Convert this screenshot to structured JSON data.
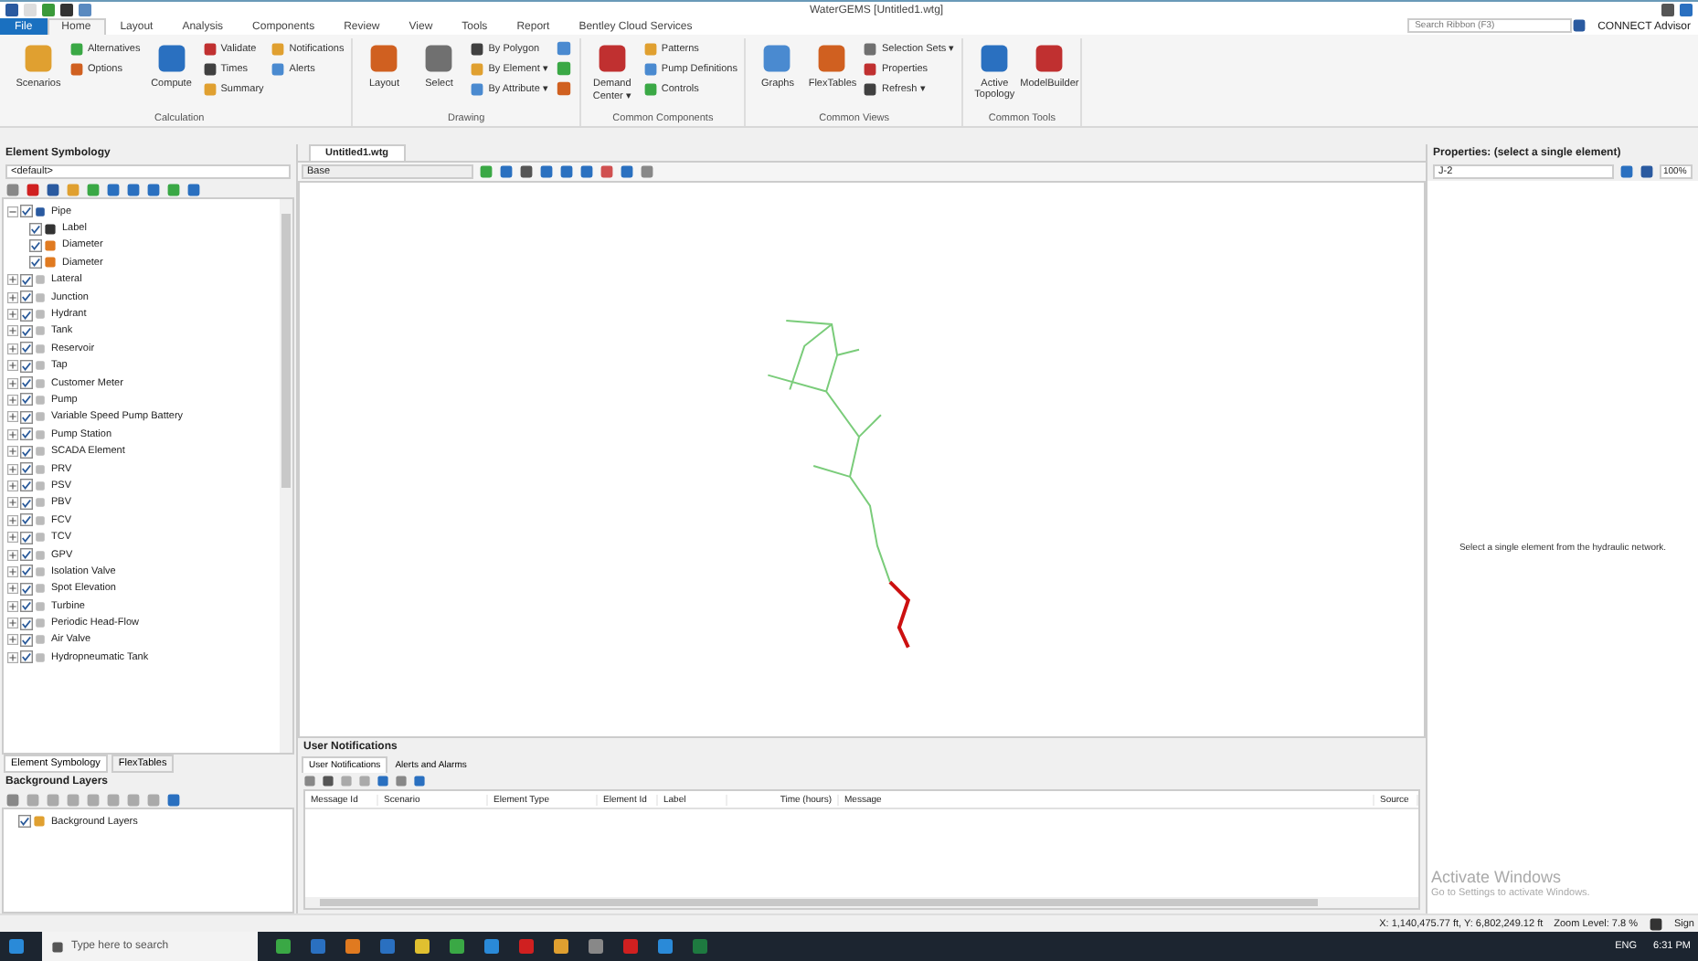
{
  "window": {
    "title": "WaterGEMS [Untitled1.wtg]"
  },
  "ribbon_tabs": [
    {
      "label": "File",
      "selected": false,
      "kind": "file"
    },
    {
      "label": "Home",
      "selected": true
    },
    {
      "label": "Layout",
      "selected": false
    },
    {
      "label": "Analysis",
      "selected": false
    },
    {
      "label": "Components",
      "selected": false
    },
    {
      "label": "Review",
      "selected": false
    },
    {
      "label": "View",
      "selected": false
    },
    {
      "label": "Tools",
      "selected": false
    },
    {
      "label": "Report",
      "selected": false
    },
    {
      "label": "Bentley Cloud Services",
      "selected": false
    }
  ],
  "ribbon_search": {
    "placeholder": "Search Ribbon (F3)"
  },
  "advisor": "CONNECT Advisor",
  "ribbon_groups": [
    {
      "label": "Calculation",
      "columns": [
        [
          {
            "kind": "large",
            "label": "Scenarios"
          }
        ],
        [
          {
            "kind": "small",
            "label": "Alternatives"
          },
          {
            "kind": "small",
            "label": "Options"
          }
        ],
        [
          {
            "kind": "large",
            "label": "Compute"
          }
        ],
        [
          {
            "kind": "small",
            "label": "Validate"
          },
          {
            "kind": "small",
            "label": "Times"
          },
          {
            "kind": "small",
            "label": "Summary"
          }
        ],
        [
          {
            "kind": "small",
            "label": "Notifications"
          },
          {
            "kind": "small",
            "label": "Alerts"
          }
        ]
      ]
    },
    {
      "label": "Drawing",
      "columns": [
        [
          {
            "kind": "large",
            "label": "Layout"
          }
        ],
        [
          {
            "kind": "large",
            "label": "Select"
          }
        ],
        [
          {
            "kind": "small",
            "label": "By Polygon"
          },
          {
            "kind": "small",
            "label": "By Element ▾"
          },
          {
            "kind": "small",
            "label": "By Attribute ▾"
          }
        ],
        [
          {
            "kind": "icon"
          },
          {
            "kind": "icon"
          },
          {
            "kind": "icon"
          }
        ]
      ]
    },
    {
      "label": "Common Components",
      "columns": [
        [
          {
            "kind": "large",
            "label": "Demand Center ▾"
          }
        ],
        [
          {
            "kind": "small",
            "label": "Patterns"
          },
          {
            "kind": "small",
            "label": "Pump Definitions"
          },
          {
            "kind": "small",
            "label": "Controls"
          }
        ]
      ]
    },
    {
      "label": "Common Views",
      "columns": [
        [
          {
            "kind": "large",
            "label": "Graphs"
          }
        ],
        [
          {
            "kind": "large",
            "label": "FlexTables"
          }
        ],
        [
          {
            "kind": "small",
            "label": "Selection Sets ▾"
          },
          {
            "kind": "small",
            "label": "Properties"
          },
          {
            "kind": "small",
            "label": "Refresh ▾"
          }
        ]
      ]
    },
    {
      "label": "Common Tools",
      "columns": [
        [
          {
            "kind": "large",
            "label": "Active Topology"
          }
        ],
        [
          {
            "kind": "large",
            "label": "ModelBuilder"
          }
        ]
      ]
    }
  ],
  "element_symbology": {
    "title": "Element Symbology",
    "dropdown": "<default>",
    "tree": [
      {
        "label": "Pipe",
        "checked": true,
        "expanded": true,
        "children": [
          {
            "label": "Label",
            "checked": true
          },
          {
            "label": "Diameter",
            "checked": true
          },
          {
            "label": "Diameter",
            "checked": true
          }
        ]
      },
      {
        "label": "Lateral",
        "checked": true,
        "expanded": false
      },
      {
        "label": "Junction",
        "checked": true,
        "expanded": false
      },
      {
        "label": "Hydrant",
        "checked": true,
        "expanded": false
      },
      {
        "label": "Tank",
        "checked": true,
        "expanded": false
      },
      {
        "label": "Reservoir",
        "checked": true,
        "expanded": false
      },
      {
        "label": "Tap",
        "checked": true,
        "expanded": false
      },
      {
        "label": "Customer Meter",
        "checked": true,
        "expanded": false
      },
      {
        "label": "Pump",
        "checked": true,
        "expanded": false
      },
      {
        "label": "Variable Speed Pump Battery",
        "checked": true,
        "expanded": false
      },
      {
        "label": "Pump Station",
        "checked": true,
        "expanded": false
      },
      {
        "label": "SCADA Element",
        "checked": true,
        "expanded": false
      },
      {
        "label": "PRV",
        "checked": true,
        "expanded": false
      },
      {
        "label": "PSV",
        "checked": true,
        "expanded": false
      },
      {
        "label": "PBV",
        "checked": true,
        "expanded": false
      },
      {
        "label": "FCV",
        "checked": true,
        "expanded": false
      },
      {
        "label": "TCV",
        "checked": true,
        "expanded": false
      },
      {
        "label": "GPV",
        "checked": true,
        "expanded": false
      },
      {
        "label": "Isolation Valve",
        "checked": true,
        "expanded": false
      },
      {
        "label": "Spot Elevation",
        "checked": true,
        "expanded": false
      },
      {
        "label": "Turbine",
        "checked": true,
        "expanded": false
      },
      {
        "label": "Periodic Head-Flow",
        "checked": true,
        "expanded": false
      },
      {
        "label": "Air Valve",
        "checked": true,
        "expanded": false
      },
      {
        "label": "Hydropneumatic Tank",
        "checked": true,
        "expanded": false
      }
    ],
    "tabs": [
      {
        "label": "Element Symbology",
        "selected": true
      },
      {
        "label": "FlexTables",
        "selected": false
      }
    ]
  },
  "background_layers": {
    "title": "Background Layers",
    "tree": [
      {
        "label": "Background Layers",
        "checked": true
      }
    ]
  },
  "document": {
    "tab": "Untitled1.wtg",
    "scenario": "Base"
  },
  "notifications": {
    "title": "User Notifications",
    "tabs": [
      {
        "label": "User Notifications",
        "selected": true
      },
      {
        "label": "Alerts and Alarms",
        "selected": false
      }
    ],
    "columns": [
      "Message Id",
      "Scenario",
      "Element Type",
      "Element Id",
      "Label",
      "Time (hours)",
      "Message",
      "Source"
    ]
  },
  "properties": {
    "title": "Properties:  (select a single element)",
    "element": "J-2",
    "zoom": "100%",
    "message": "Select a single element from the hydraulic network."
  },
  "activation": {
    "title": "Activate Windows",
    "text": "Go to Settings to activate Windows."
  },
  "status_bar": {
    "coordinates": "X: 1,140,475.77 ft, Y: 6,802,249.12 ft",
    "zoom": "Zoom Level: 7.8 %",
    "user": "Sign"
  },
  "taskbar": {
    "search_placeholder": "Type here to search",
    "language": "ENG",
    "time": "6:31 PM"
  }
}
